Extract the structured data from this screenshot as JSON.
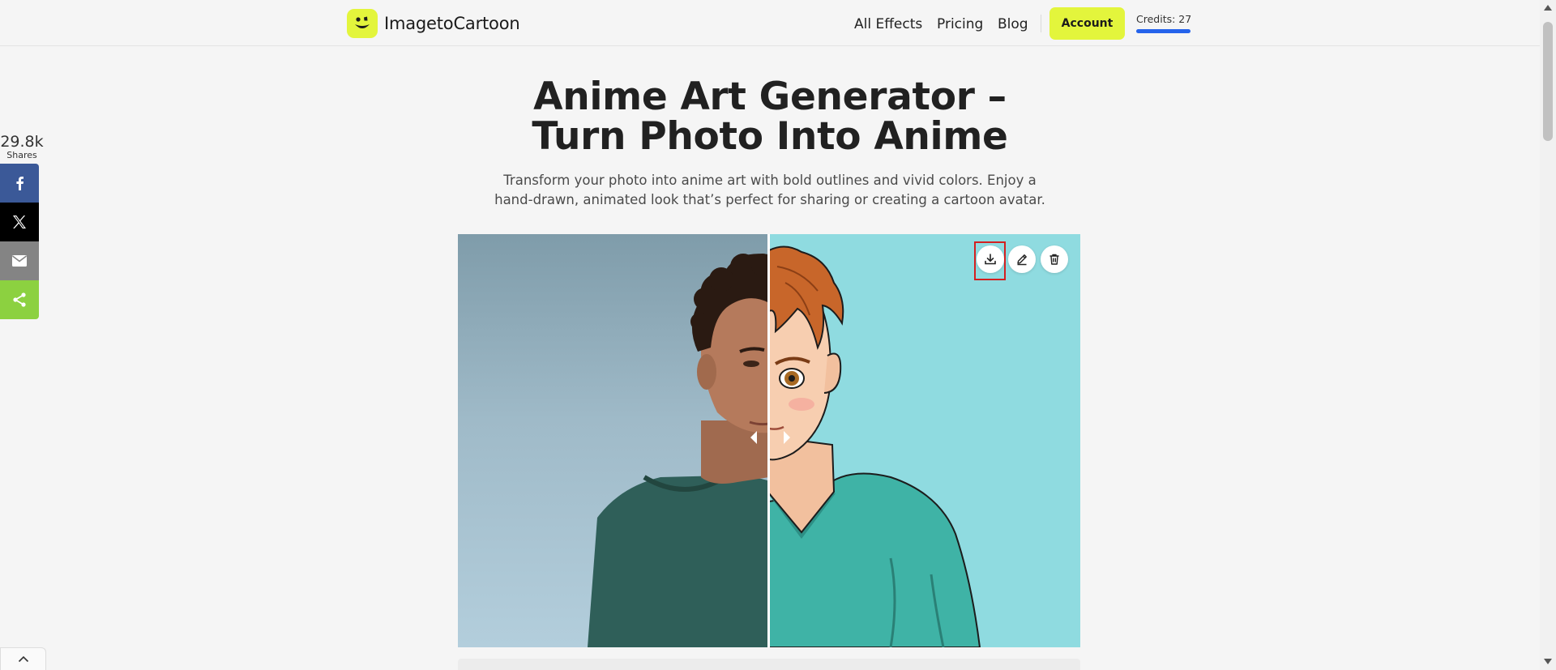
{
  "header": {
    "brand": "ImagetoCartoon",
    "nav": [
      "All Effects",
      "Pricing",
      "Blog"
    ],
    "account_label": "Account",
    "credits_label": "Credits: 27"
  },
  "hero": {
    "title_line1": "Anime Art Generator –",
    "title_line2": "Turn Photo Into Anime",
    "subtitle_line1": "Transform your photo into anime art with bold outlines and vivid colors. Enjoy a",
    "subtitle_line2": "hand-drawn, animated look that’s perfect for sharing or creating a cartoon avatar."
  },
  "share": {
    "count": "29.8k",
    "label": "Shares",
    "buttons": [
      "facebook-icon",
      "x-icon",
      "email-icon",
      "share-icon"
    ]
  },
  "compare": {
    "actions": [
      "download-icon",
      "edit-icon",
      "delete-icon"
    ]
  },
  "colors": {
    "accent": "#e3f53c",
    "credits_bar": "#2563eb",
    "facebook": "#3b5998",
    "x": "#000000",
    "email": "#848484",
    "share": "#8cd140",
    "highlight": "#d42020"
  }
}
